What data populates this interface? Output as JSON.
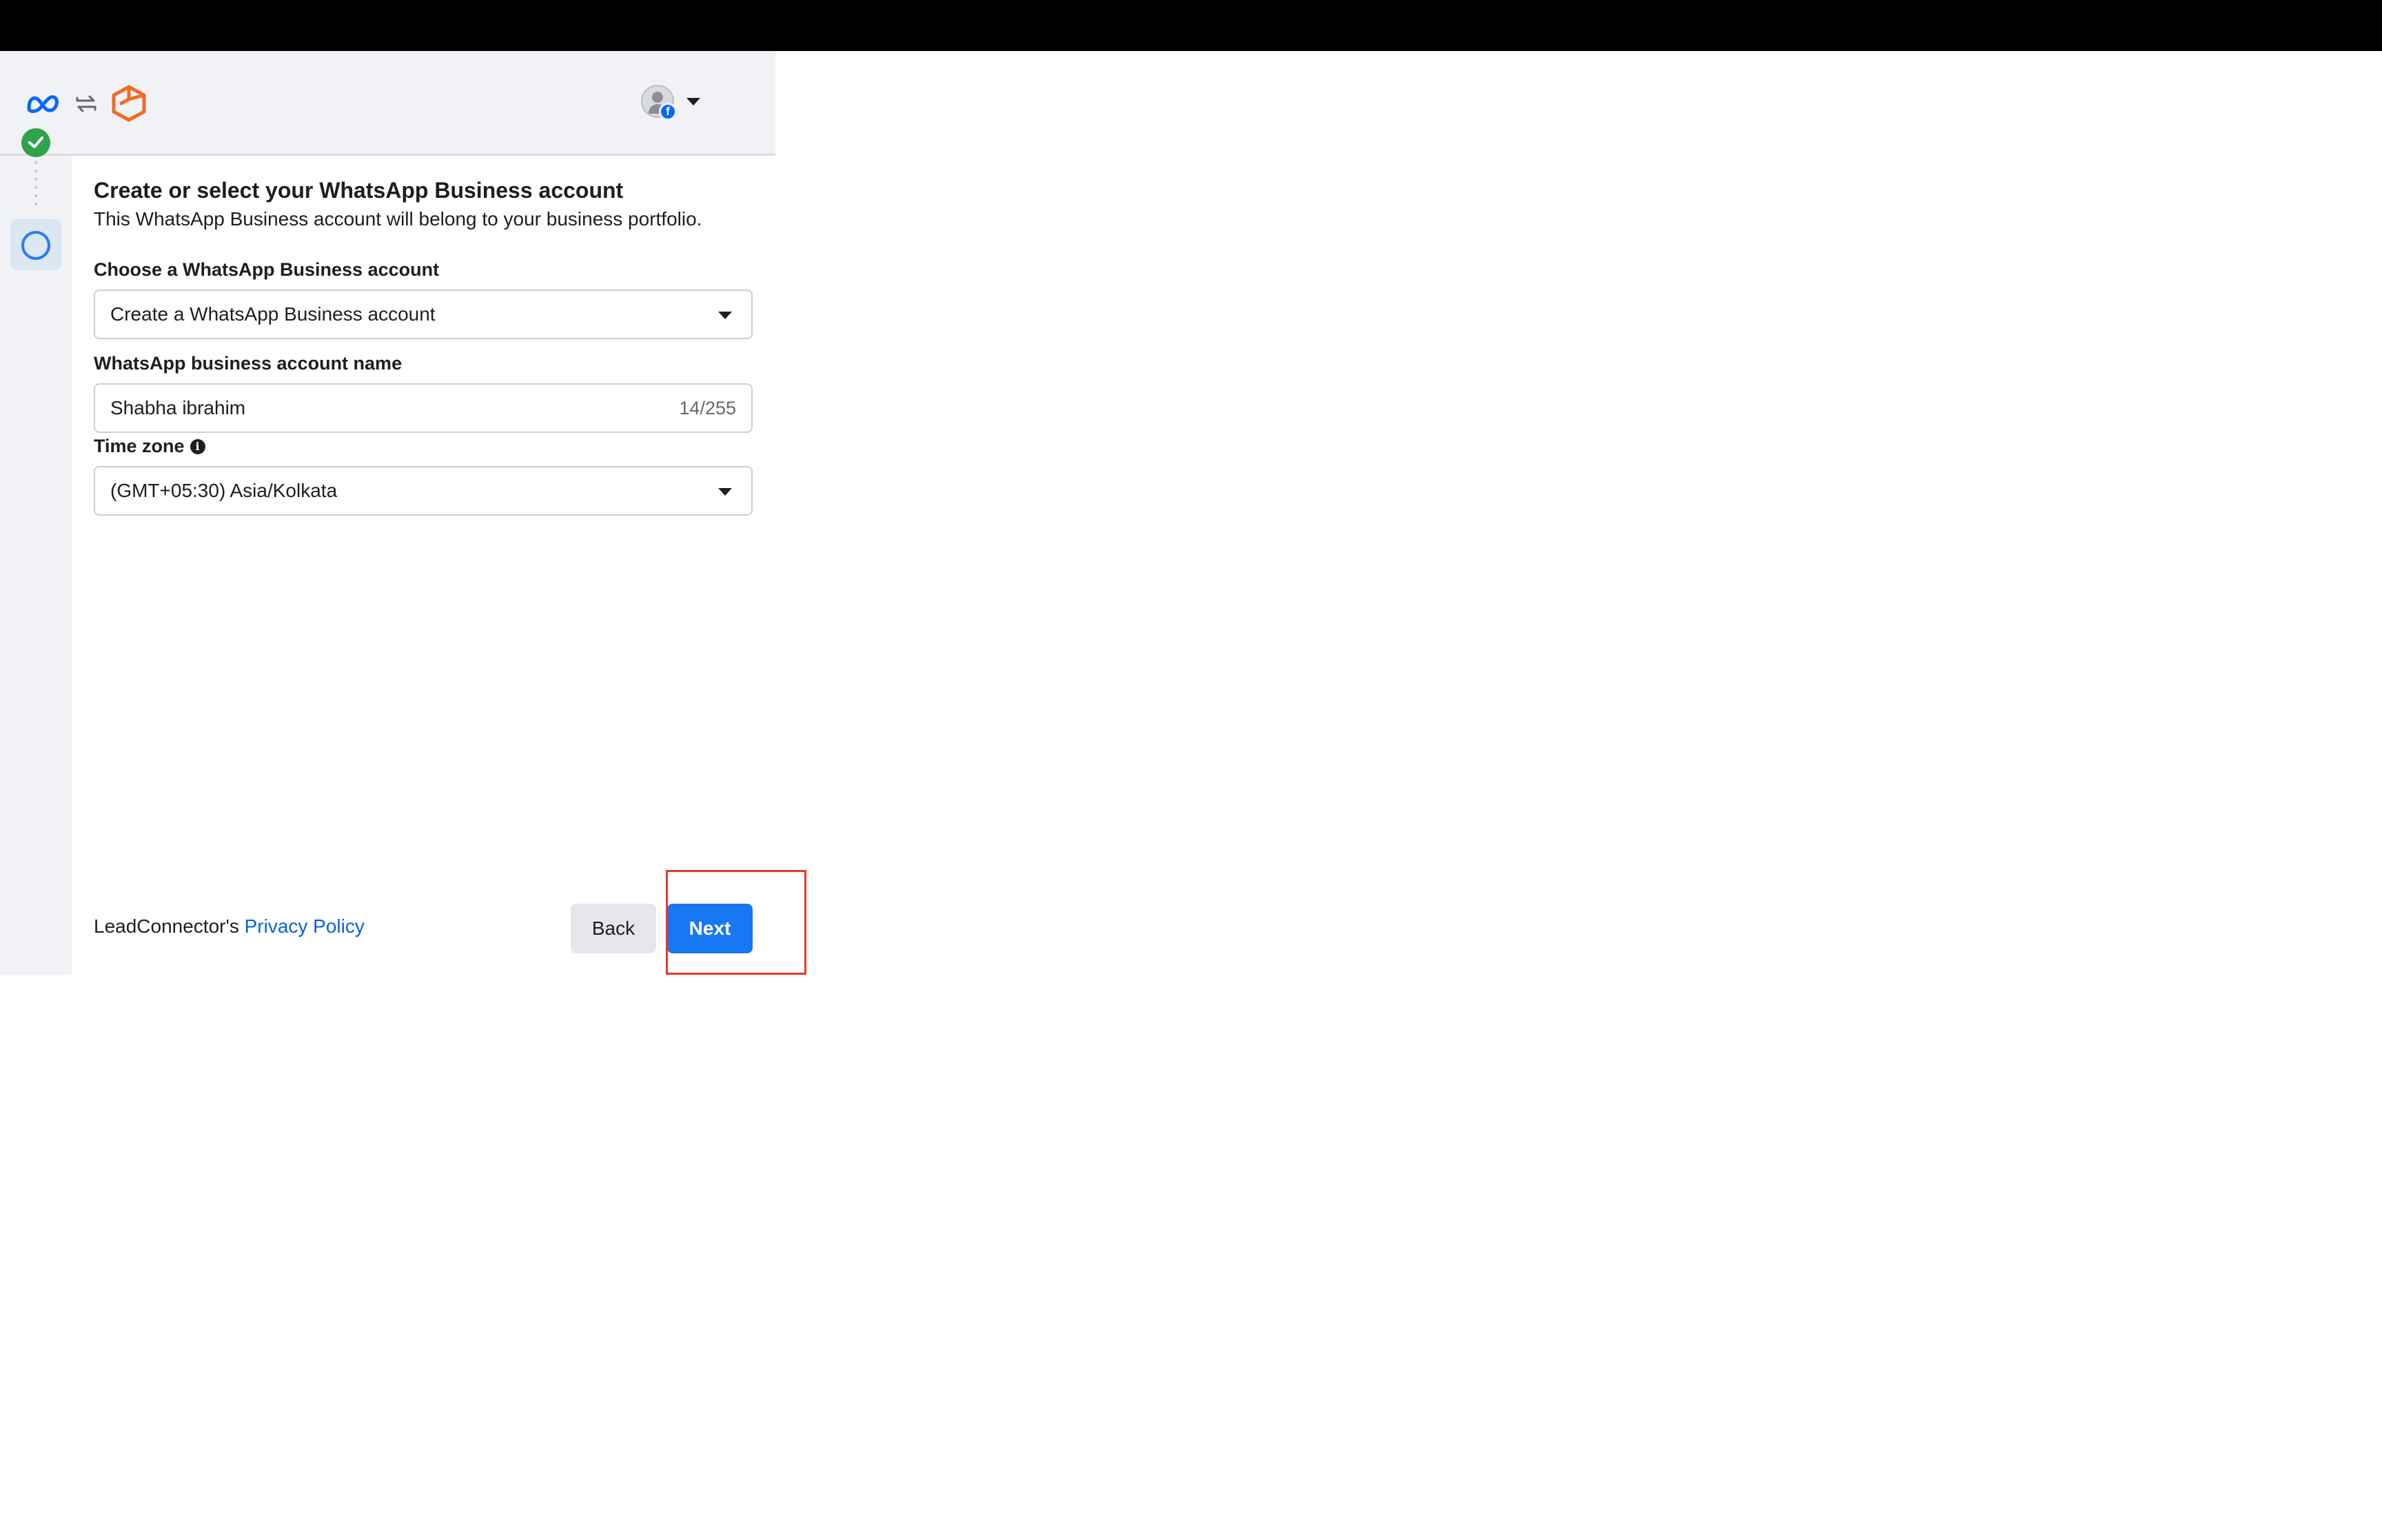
{
  "header": {
    "logos": [
      "meta-logo",
      "sync-arrows-icon",
      "leadconnector-logo"
    ],
    "account_menu": "account-switcher"
  },
  "stepper": {
    "steps": [
      {
        "status": "complete",
        "icon": "check-icon"
      },
      {
        "status": "current",
        "icon": "circle-icon"
      }
    ]
  },
  "form": {
    "title": "Create or select your WhatsApp Business account",
    "subtitle": "This WhatsApp Business account will belong to your business portfolio.",
    "account_select": {
      "label": "Choose a WhatsApp Business account",
      "value": "Create a WhatsApp Business account"
    },
    "account_name": {
      "label": "WhatsApp business account name",
      "value": "Shabha ibrahim",
      "counter": "14/255"
    },
    "time_zone": {
      "label": "Time zone",
      "info_icon": "i",
      "value": "(GMT+05:30) Asia/Kolkata"
    }
  },
  "footer": {
    "policy_prefix": "LeadConnector's",
    "policy_link": "Privacy Policy",
    "back_label": "Back",
    "next_label": "Next"
  },
  "colors": {
    "primary": "#1877f2",
    "success": "#31a24c",
    "link": "#0a5fd6",
    "highlight": "#e8372b",
    "meta_blue": "#0866ff",
    "brand_orange": "#f26b21"
  }
}
